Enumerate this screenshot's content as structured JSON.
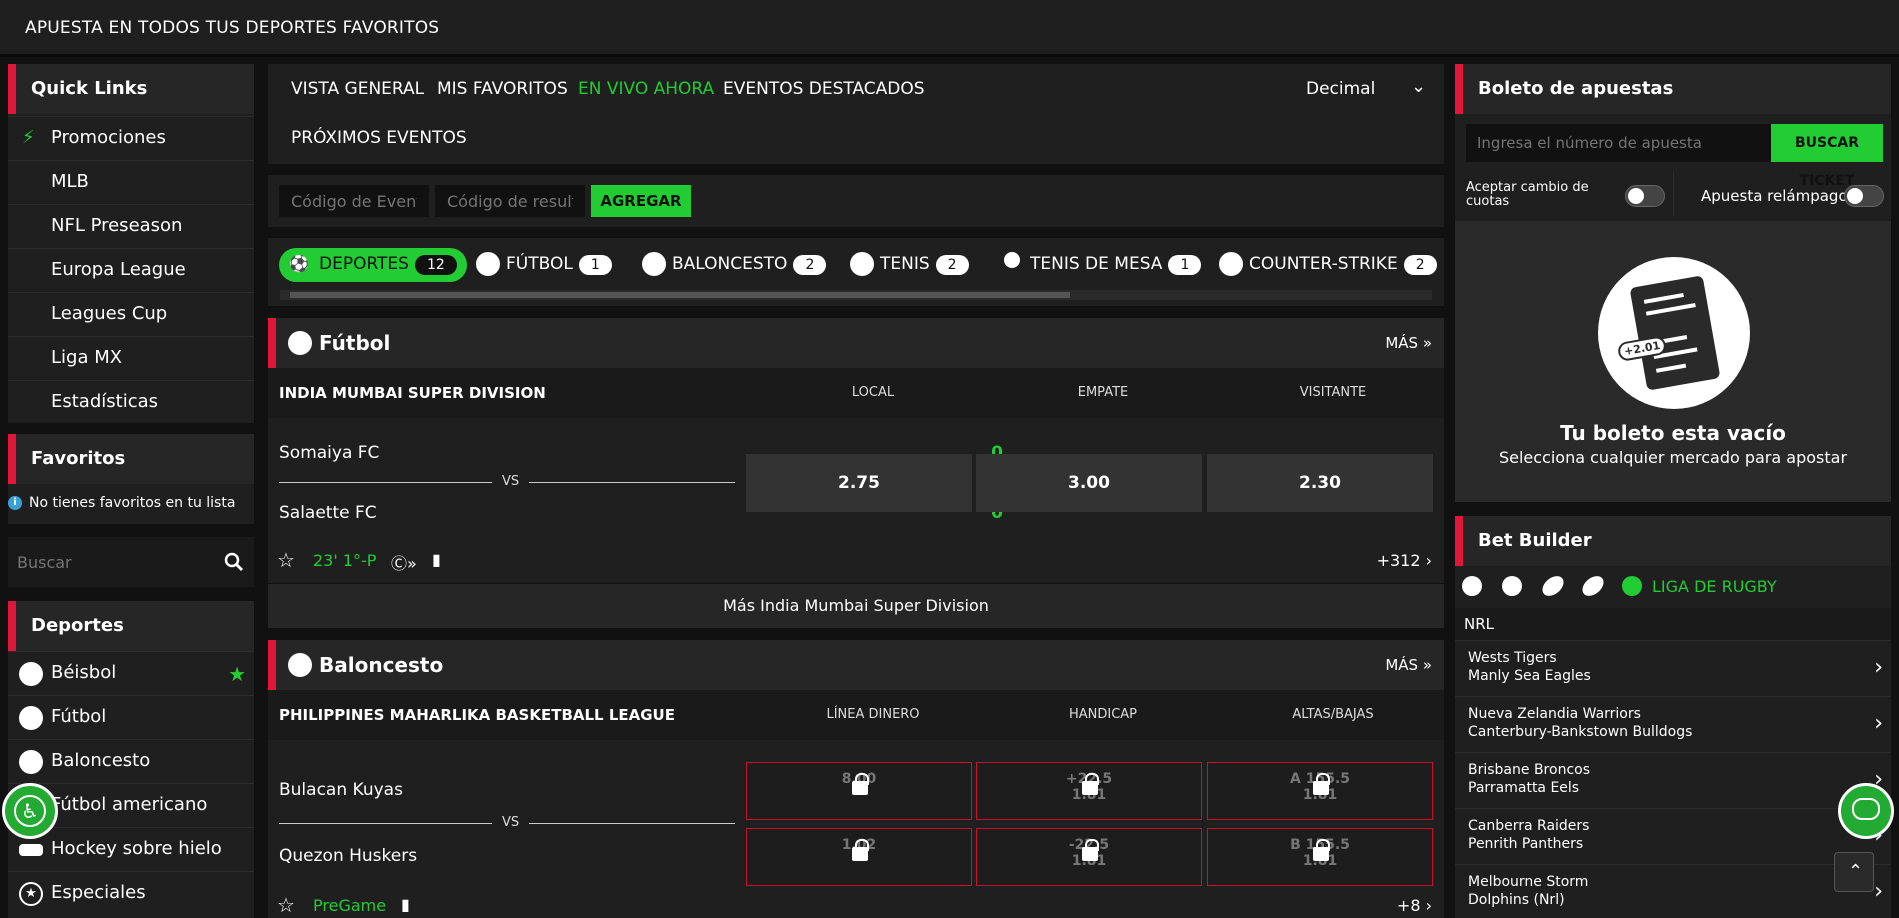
{
  "topbar": {
    "title": "APUESTA EN TODOS TUS DEPORTES FAVORITOS"
  },
  "quicklinks": {
    "title": "Quick Links",
    "items": [
      "Promociones",
      "MLB",
      "NFL Preseason",
      "Europa League",
      "Leagues Cup",
      "Liga MX",
      "Estadísticas"
    ]
  },
  "favoritos": {
    "title": "Favoritos",
    "empty": "No tienes favoritos en tu lista"
  },
  "search": {
    "placeholder": "Buscar"
  },
  "deportes": {
    "title": "Deportes",
    "items": [
      "Béisbol",
      "Fútbol",
      "Baloncesto",
      "Fútbol americano",
      "Hockey sobre hielo",
      "Especiales"
    ]
  },
  "nav": {
    "items": [
      "VISTA GENERAL",
      "MIS FAVORITOS",
      "EN VIVO AHORA",
      "EVENTOS DESTACADOS",
      "PRÓXIMOS EVENTOS"
    ],
    "odds_format": "Decimal"
  },
  "codebar": {
    "event_placeholder": "Código de Evento",
    "result_placeholder": "Código de resultado",
    "add": "AGREGAR"
  },
  "sports_chips": [
    {
      "label": "DEPORTES",
      "count": "12"
    },
    {
      "label": "FÚTBOL",
      "count": "1"
    },
    {
      "label": "BALONCESTO",
      "count": "2"
    },
    {
      "label": "TENIS",
      "count": "2"
    },
    {
      "label": "TENIS DE MESA",
      "count": "1"
    },
    {
      "label": "COUNTER-STRIKE",
      "count": "2"
    }
  ],
  "futbol": {
    "title": "Fútbol",
    "more": "MÁS",
    "league": "INDIA MUMBAI SUPER DIVISION",
    "cols": [
      "LOCAL",
      "EMPATE",
      "VISITANTE"
    ],
    "home": "Somaiya FC",
    "away": "Salaette FC",
    "home_score": "0",
    "away_score": "0",
    "vs": "VS",
    "odds": [
      "2.75",
      "3.00",
      "2.30"
    ],
    "time": "23' 1°-P",
    "markets": "+312",
    "more_league": "Más India Mumbai Super Division"
  },
  "baloncesto": {
    "title": "Baloncesto",
    "more": "MÁS",
    "league": "PHILIPPINES MAHARLIKA BASKETBALL LEAGUE",
    "cols": [
      "LÍNEA DINERO",
      "HANDICAP",
      "ALTAS/BAJAS"
    ],
    "home": "Bulacan Kuyas",
    "away": "Quezon Huskers",
    "home_score": "--",
    "away_score": "--",
    "vs": "VS",
    "row1": [
      "8.00",
      "+22.5",
      "1.81",
      "A 155.5",
      "1.81"
    ],
    "row2": [
      "1.02",
      "-22.5",
      "1.81",
      "B 155.5",
      "1.81"
    ],
    "status": "PreGame",
    "markets": "+8"
  },
  "slip": {
    "title": "Boleto de apuestas",
    "placeholder": "Ingresa el número de apuesta",
    "search_btn": "BUSCAR TICKET",
    "accept_changes": "Aceptar cambio de cuotas",
    "quick_bet": "Apuesta relámpago",
    "empty_title": "Tu boleto esta vacío",
    "empty_sub": "Selecciona cualquier mercado para apostar",
    "ticket_odds": "+2.01"
  },
  "betbuilder": {
    "title": "Bet Builder",
    "league": "LIGA DE RUGBY",
    "group": "NRL",
    "matches": [
      [
        "Wests Tigers",
        "Manly Sea Eagles"
      ],
      [
        "Nueva Zelandia Warriors",
        "Canterbury-Bankstown Bulldogs"
      ],
      [
        "Brisbane Broncos",
        "Parramatta Eels"
      ],
      [
        "Canberra Raiders",
        "Penrith Panthers"
      ],
      [
        "Melbourne Storm",
        "Dolphins (Nrl)"
      ]
    ]
  },
  "colors": {
    "accent": "#22cc33",
    "brand_red": "#e0173a"
  }
}
